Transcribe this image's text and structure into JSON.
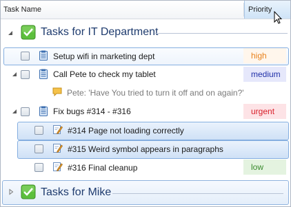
{
  "header": {
    "task_name": "Task Name",
    "priority": "Priority"
  },
  "groups": [
    {
      "title": "Tasks for IT Department"
    },
    {
      "title": "Tasks for Mike"
    }
  ],
  "tasks": [
    {
      "label": "Setup wifi in marketing dept",
      "priority": "high"
    },
    {
      "label": "Call Pete to check my tablet",
      "priority": "medium"
    },
    {
      "label": "Pete: 'Have You tried to turn it off and on again?'"
    },
    {
      "label": "Fix bugs #314 - #316",
      "priority": "urgent"
    },
    {
      "label": "#314  Page not loading correctly"
    },
    {
      "label": "#315  Weird symbol appears in paragraphs"
    },
    {
      "label": "#316  Final cleanup",
      "priority": "low"
    }
  ],
  "colors": {
    "high_text": "#e8821e",
    "high_bg": "#fff6ec",
    "medium_text": "#2030a8",
    "medium_bg": "#e6e8fb",
    "urgent_text": "#d8202a",
    "urgent_bg": "#fde3e6",
    "low_text": "#3a8a2e",
    "low_bg": "#e4f3e0",
    "group_title": "#1e3b6e",
    "selection": "#cfe1f6"
  },
  "icons": [
    "sort-cursor-icon",
    "group-check-icon",
    "clipboard-icon",
    "comment-icon",
    "pencil-note-icon",
    "expand-arrow-icon",
    "collapse-arrow-icon"
  ]
}
